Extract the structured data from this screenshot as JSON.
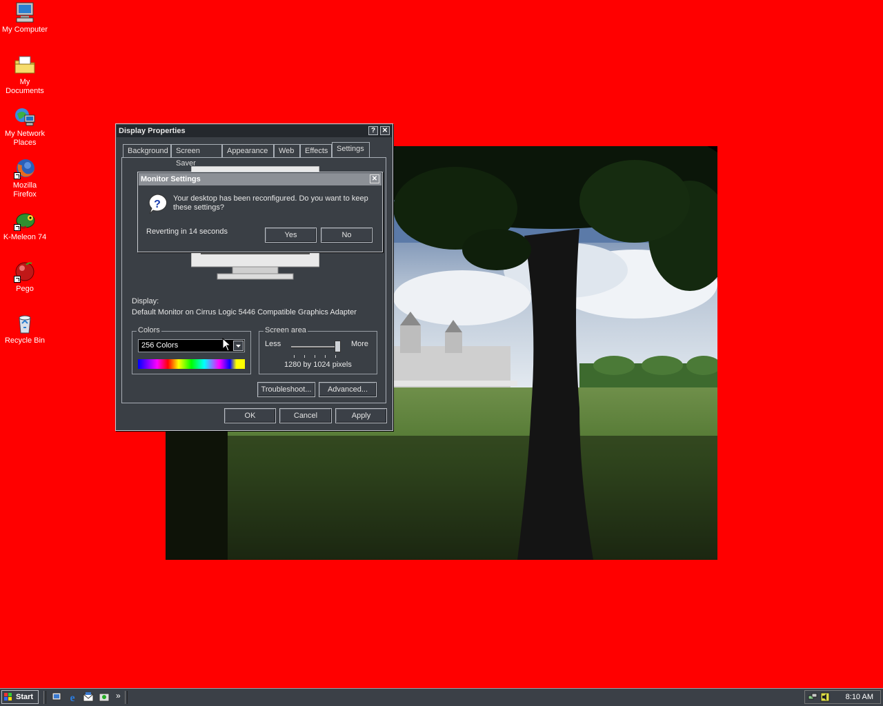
{
  "desktop": {
    "background_color": "#ff0000",
    "icons": [
      {
        "label": "My Computer",
        "icon": "computer-icon",
        "shortcut": false
      },
      {
        "label": "My Documents",
        "icon": "folder-icon",
        "shortcut": false
      },
      {
        "label": "My Network Places",
        "icon": "network-icon",
        "shortcut": false
      },
      {
        "label": "Mozilla Firefox",
        "icon": "firefox-icon",
        "shortcut": true
      },
      {
        "label": "K-Meleon 74",
        "icon": "chameleon-icon",
        "shortcut": true
      },
      {
        "label": "Pego",
        "icon": "pego-icon",
        "shortcut": true
      },
      {
        "label": "Recycle Bin",
        "icon": "recycle-bin-icon",
        "shortcut": false
      }
    ]
  },
  "display_properties": {
    "title": "Display Properties",
    "help_button": "?",
    "close_button": "✕",
    "tabs": [
      "Background",
      "Screen Saver",
      "Appearance",
      "Web",
      "Effects",
      "Settings"
    ],
    "active_tab": "Settings",
    "display_label": "Display:",
    "display_value": "Default Monitor on Cirrus Logic 5446 Compatible Graphics Adapter",
    "colors_label": "Colors",
    "colors_value": "256 Colors",
    "screen_area_label": "Screen area",
    "less_label": "Less",
    "more_label": "More",
    "resolution_text": "1280 by 1024 pixels",
    "slider_level": 1.0,
    "troubleshoot_button": "Troubleshoot...",
    "advanced_button": "Advanced...",
    "ok_button": "OK",
    "cancel_button": "Cancel",
    "apply_button": "Apply"
  },
  "monitor_settings": {
    "title": "Monitor Settings",
    "close_button": "✕",
    "message": "Your desktop has been reconfigured.  Do you want to keep these settings?",
    "countdown": "Reverting in 14 seconds",
    "yes_button": "Yes",
    "no_button": "No"
  },
  "taskbar": {
    "start_label": "Start",
    "quick_launch": [
      "show-desktop-icon",
      "internet-explorer-icon",
      "outlook-express-icon",
      "media-icon"
    ],
    "chevron": "»",
    "clock": "8:10 AM",
    "tray_icons": [
      "network-tray-icon",
      "volume-tray-icon"
    ]
  },
  "colors": {
    "desktop": "#ff0000",
    "window_bg": "#3a3f45",
    "title_active": "#24282d",
    "title_inactive": "#8c9096"
  }
}
